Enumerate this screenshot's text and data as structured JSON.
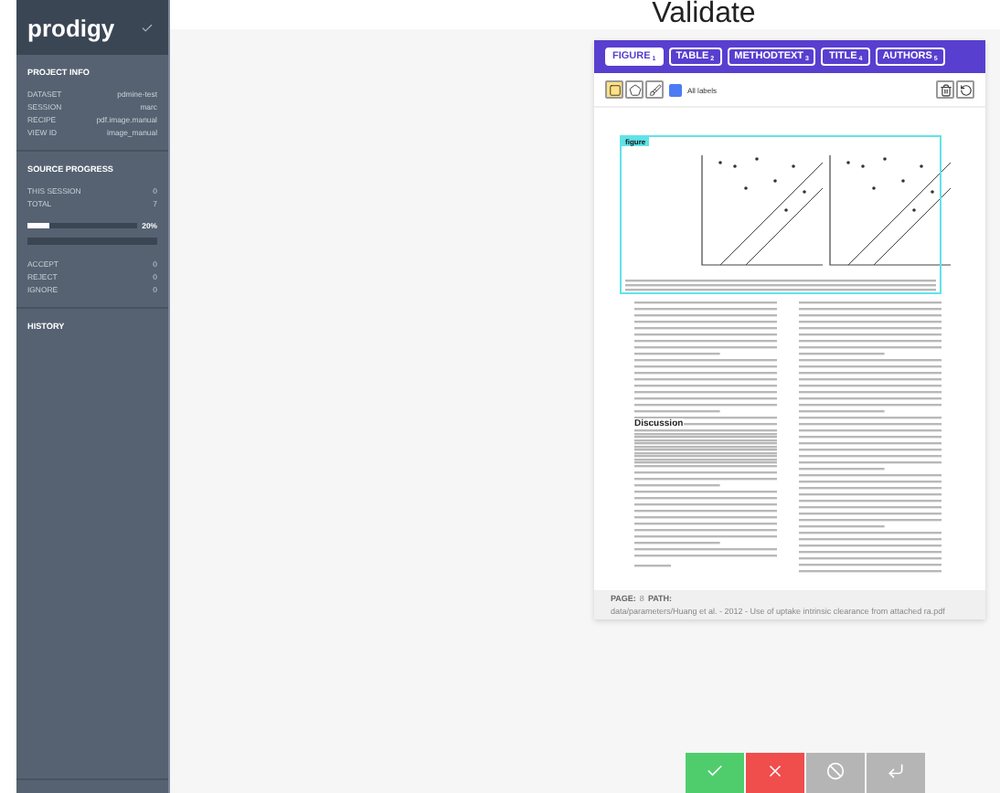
{
  "header": {
    "title": "Validate"
  },
  "sidebar": {
    "brand": "prodigy",
    "project_info": {
      "title": "PROJECT INFO",
      "rows": [
        {
          "label": "DATASET",
          "value": "pdmine-test"
        },
        {
          "label": "SESSION",
          "value": "marc"
        },
        {
          "label": "RECIPE",
          "value": "pdf.image.manual"
        },
        {
          "label": "VIEW ID",
          "value": "image_manual"
        }
      ]
    },
    "progress": {
      "title": "SOURCE PROGRESS",
      "rows": [
        {
          "label": "THIS SESSION",
          "value": "0"
        },
        {
          "label": "TOTAL",
          "value": "7"
        }
      ],
      "level": 0.2,
      "percent": "20%",
      "answers": [
        {
          "label": "ACCEPT",
          "value": "0"
        },
        {
          "label": "REJECT",
          "value": "0"
        },
        {
          "label": "IGNORE",
          "value": "0"
        }
      ]
    },
    "history": {
      "title": "HISTORY"
    }
  },
  "labels": [
    {
      "text": "FIGURE",
      "key": "1",
      "selected": true
    },
    {
      "text": "TABLE",
      "key": "2",
      "selected": false
    },
    {
      "text": "METHODTEXT",
      "key": "3",
      "selected": false
    },
    {
      "text": "TITLE",
      "key": "4",
      "selected": false
    },
    {
      "text": "AUTHORS",
      "key": "5",
      "selected": false
    }
  ],
  "tools": [
    {
      "kind": "rect",
      "selected": true
    },
    {
      "kind": "polygon",
      "selected": false
    },
    {
      "kind": "freehand",
      "selected": false
    }
  ],
  "all_labels": {
    "label": "All labels",
    "checked": true
  },
  "document": {
    "box_label": "figure",
    "heading": "Discussion",
    "footer": {
      "page_label": "PAGE:",
      "page": "8",
      "path_label": "PATH:",
      "path": "data/parameters/Huang et al. - 2012 - Use of uptake intrinsic clearance from attached ra.pdf"
    }
  },
  "actions": [
    {
      "kind": "accept"
    },
    {
      "kind": "reject"
    },
    {
      "kind": "ignore"
    },
    {
      "kind": "undo"
    }
  ]
}
